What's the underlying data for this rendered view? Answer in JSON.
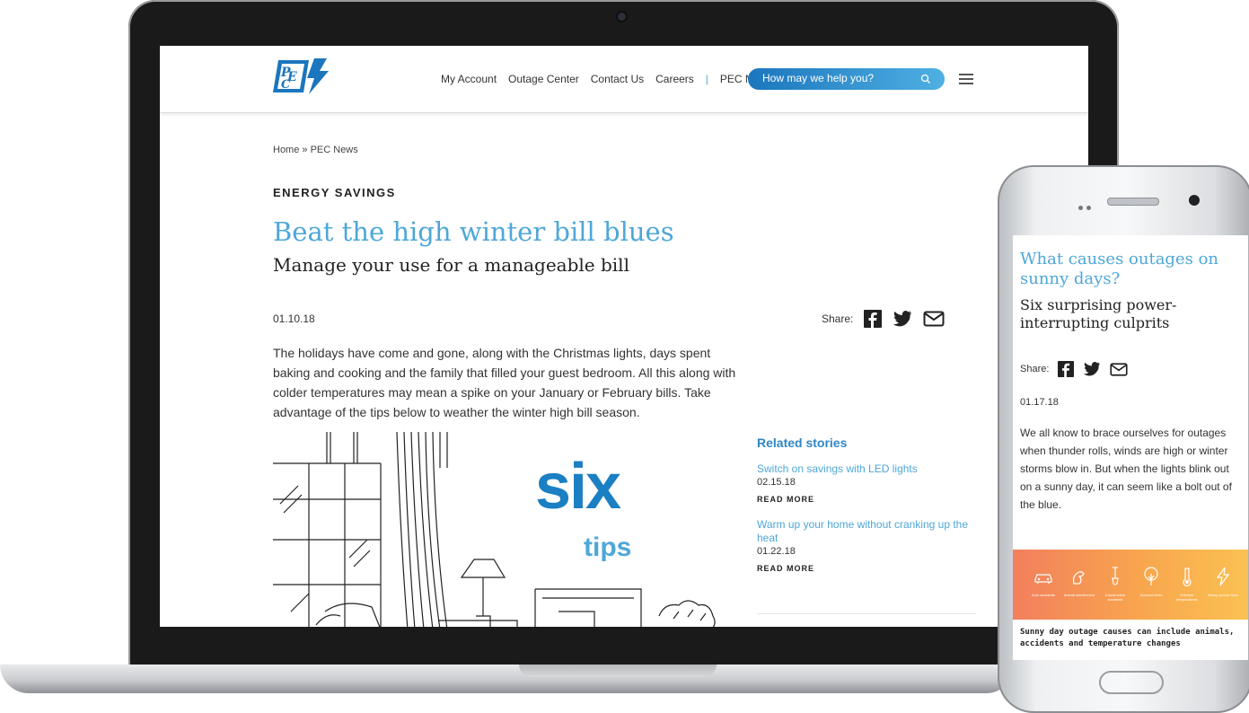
{
  "header": {
    "nav": [
      "My Account",
      "Outage Center",
      "Contact Us",
      "Careers"
    ],
    "nav_separator": "|",
    "nav_news": "PEC News",
    "search_placeholder": "How may we help you?",
    "logo_text": "PEC",
    "accent_color": "#4ea7d8"
  },
  "breadcrumb": "Home » PEC News",
  "article": {
    "category": "ENERGY SAVINGS",
    "title": "Beat the high winter bill blues",
    "subtitle": "Manage your use for a manageable bill",
    "date": "01.10.18",
    "share_label": "Share:",
    "body": "The holidays have come and gone, along with the Christmas lights, days spent baking and cooking and the family that filled your guest bedroom. All this along with colder temperatures may mean a spike on your January or February bills. Take advantage of the tips below to weather the winter high bill season.",
    "graphic_word1": "six",
    "graphic_word2": "tips"
  },
  "related": {
    "heading": "Related stories",
    "items": [
      {
        "title": "Switch on savings with LED lights",
        "date": "02.15.18",
        "more": "READ MORE"
      },
      {
        "title": "Warm up your home without cranking up the heat",
        "date": "01.22.18",
        "more": "READ MORE"
      }
    ]
  },
  "mobile": {
    "title": "What causes outages on sunny days?",
    "subtitle": "Six surprising power-interrupting culprits",
    "share_label": "Share:",
    "date": "01.17.18",
    "body": "We all know to brace ourselves for outages when thunder rolls, winds are high or winter storms blow in. But when the lights blink out on a sunny day, it can seem like a bolt out of the blue.",
    "banner_labels": [
      "Auto accidents",
      "Animal interference",
      "Construction accidents",
      "Downed trees",
      "Extreme temperatures",
      "Heavy service lines"
    ],
    "caption": "Sunny day outage causes can include animals, accidents and temperature changes"
  }
}
